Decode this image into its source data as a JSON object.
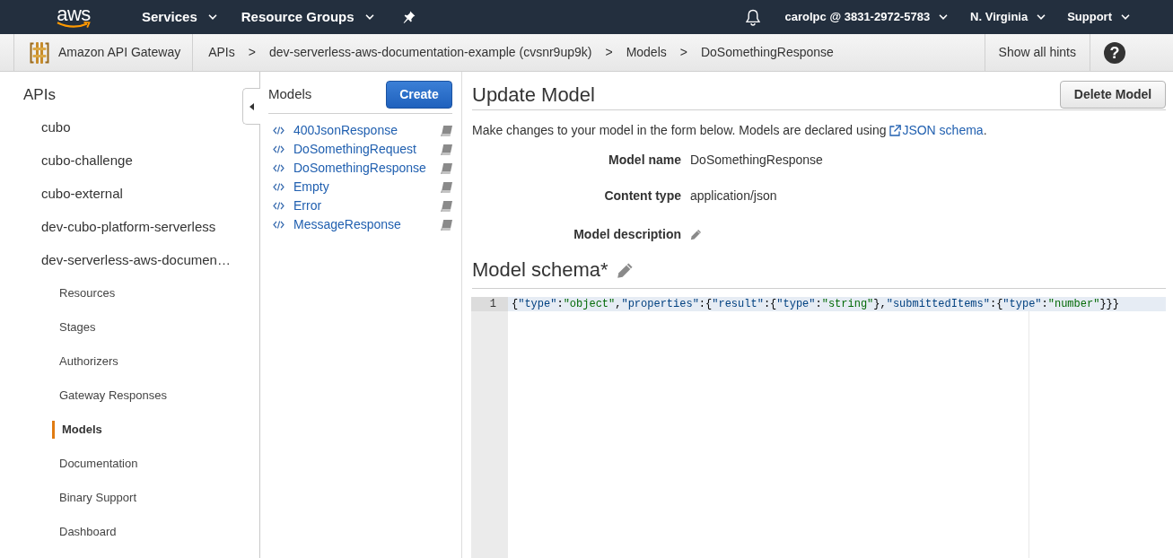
{
  "top_nav": {
    "logo": "aws",
    "menus": [
      {
        "label": "Services"
      },
      {
        "label": "Resource Groups"
      }
    ],
    "right_menus": [
      {
        "label": "carolpc @ 3831-2972-5783"
      },
      {
        "label": "N. Virginia"
      },
      {
        "label": "Support"
      }
    ]
  },
  "breadcrumb_bar": {
    "service": "Amazon API Gateway",
    "crumbs": [
      {
        "label": "APIs"
      },
      {
        "separator": ">",
        "label": "dev-serverless-aws-documentation-example (cvsnr9up9k)"
      },
      {
        "separator": ">",
        "label": "Models"
      },
      {
        "separator": ">",
        "label": "DoSomethingResponse"
      }
    ],
    "hints_button": "Show all hints",
    "help_button": "?"
  },
  "sidebar": {
    "title": "APIs",
    "apis": [
      {
        "label": "cubo"
      },
      {
        "label": "cubo-challenge"
      },
      {
        "label": "cubo-external"
      },
      {
        "label": "dev-cubo-platform-serverless"
      },
      {
        "label": "dev-serverless-aws-documen…",
        "children": [
          {
            "label": "Resources",
            "selected": false
          },
          {
            "label": "Stages",
            "selected": false
          },
          {
            "label": "Authorizers",
            "selected": false
          },
          {
            "label": "Gateway Responses",
            "selected": false
          },
          {
            "label": "Models",
            "selected": true
          },
          {
            "label": "Documentation",
            "selected": false
          },
          {
            "label": "Binary Support",
            "selected": false
          },
          {
            "label": "Dashboard",
            "selected": false
          }
        ]
      }
    ]
  },
  "models_panel": {
    "title": "Models",
    "create_button": "Create",
    "models": [
      {
        "name": "400JsonResponse"
      },
      {
        "name": "DoSomethingRequest"
      },
      {
        "name": "DoSomethingResponse"
      },
      {
        "name": "Empty"
      },
      {
        "name": "Error"
      },
      {
        "name": "MessageResponse"
      }
    ]
  },
  "main": {
    "title": "Update Model",
    "delete_button": "Delete Model",
    "intro": {
      "text_before": "Make changes to your model in the form below. Models are declared using ",
      "link": "JSON schema",
      "text_after": "."
    },
    "fields": [
      {
        "kind": "text",
        "label": "Model name",
        "value": "DoSomethingResponse"
      },
      {
        "kind": "text",
        "label": "Content type",
        "value": "application/json"
      },
      {
        "kind": "edit",
        "label": "Model description"
      }
    ],
    "schema": {
      "title": "Model schema*",
      "lines": [
        {
          "number": "1",
          "code": "{\"type\":\"object\",\"properties\":{\"result\":{\"type\":\"string\"},\"submittedItems\":{\"type\":\"number\"}}}",
          "active": true
        }
      ]
    }
  }
}
